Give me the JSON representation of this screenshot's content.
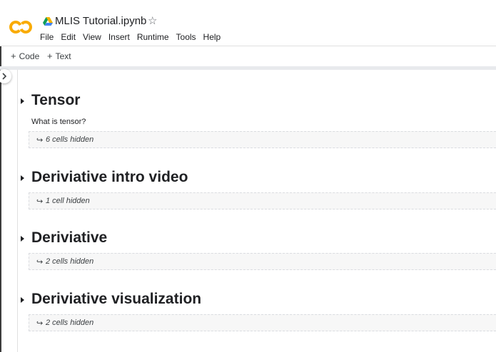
{
  "header": {
    "notebook_title": "MLIS Tutorial.ipynb",
    "star_glyph": "☆",
    "menu": [
      "File",
      "Edit",
      "View",
      "Insert",
      "Runtime",
      "Tools",
      "Help"
    ]
  },
  "toolbar": {
    "add_code_label": "Code",
    "add_text_label": "Text",
    "plus_glyph": "+"
  },
  "colors": {
    "logo_orange": "#f9ab00",
    "drive_green": "#0f9d58",
    "drive_blue": "#4285f4",
    "drive_yellow": "#f4b400"
  },
  "sections": [
    {
      "heading": "Tensor",
      "text": "What is tensor?",
      "hidden": "6 cells hidden"
    },
    {
      "heading": "Deriviative intro video",
      "text": "",
      "hidden": "1 cell hidden"
    },
    {
      "heading": "Deriviative",
      "text": "",
      "hidden": "2 cells hidden"
    },
    {
      "heading": "Deriviative visualization",
      "text": "",
      "hidden": "2 cells hidden"
    }
  ],
  "hidden_arrow_glyph": "↪"
}
